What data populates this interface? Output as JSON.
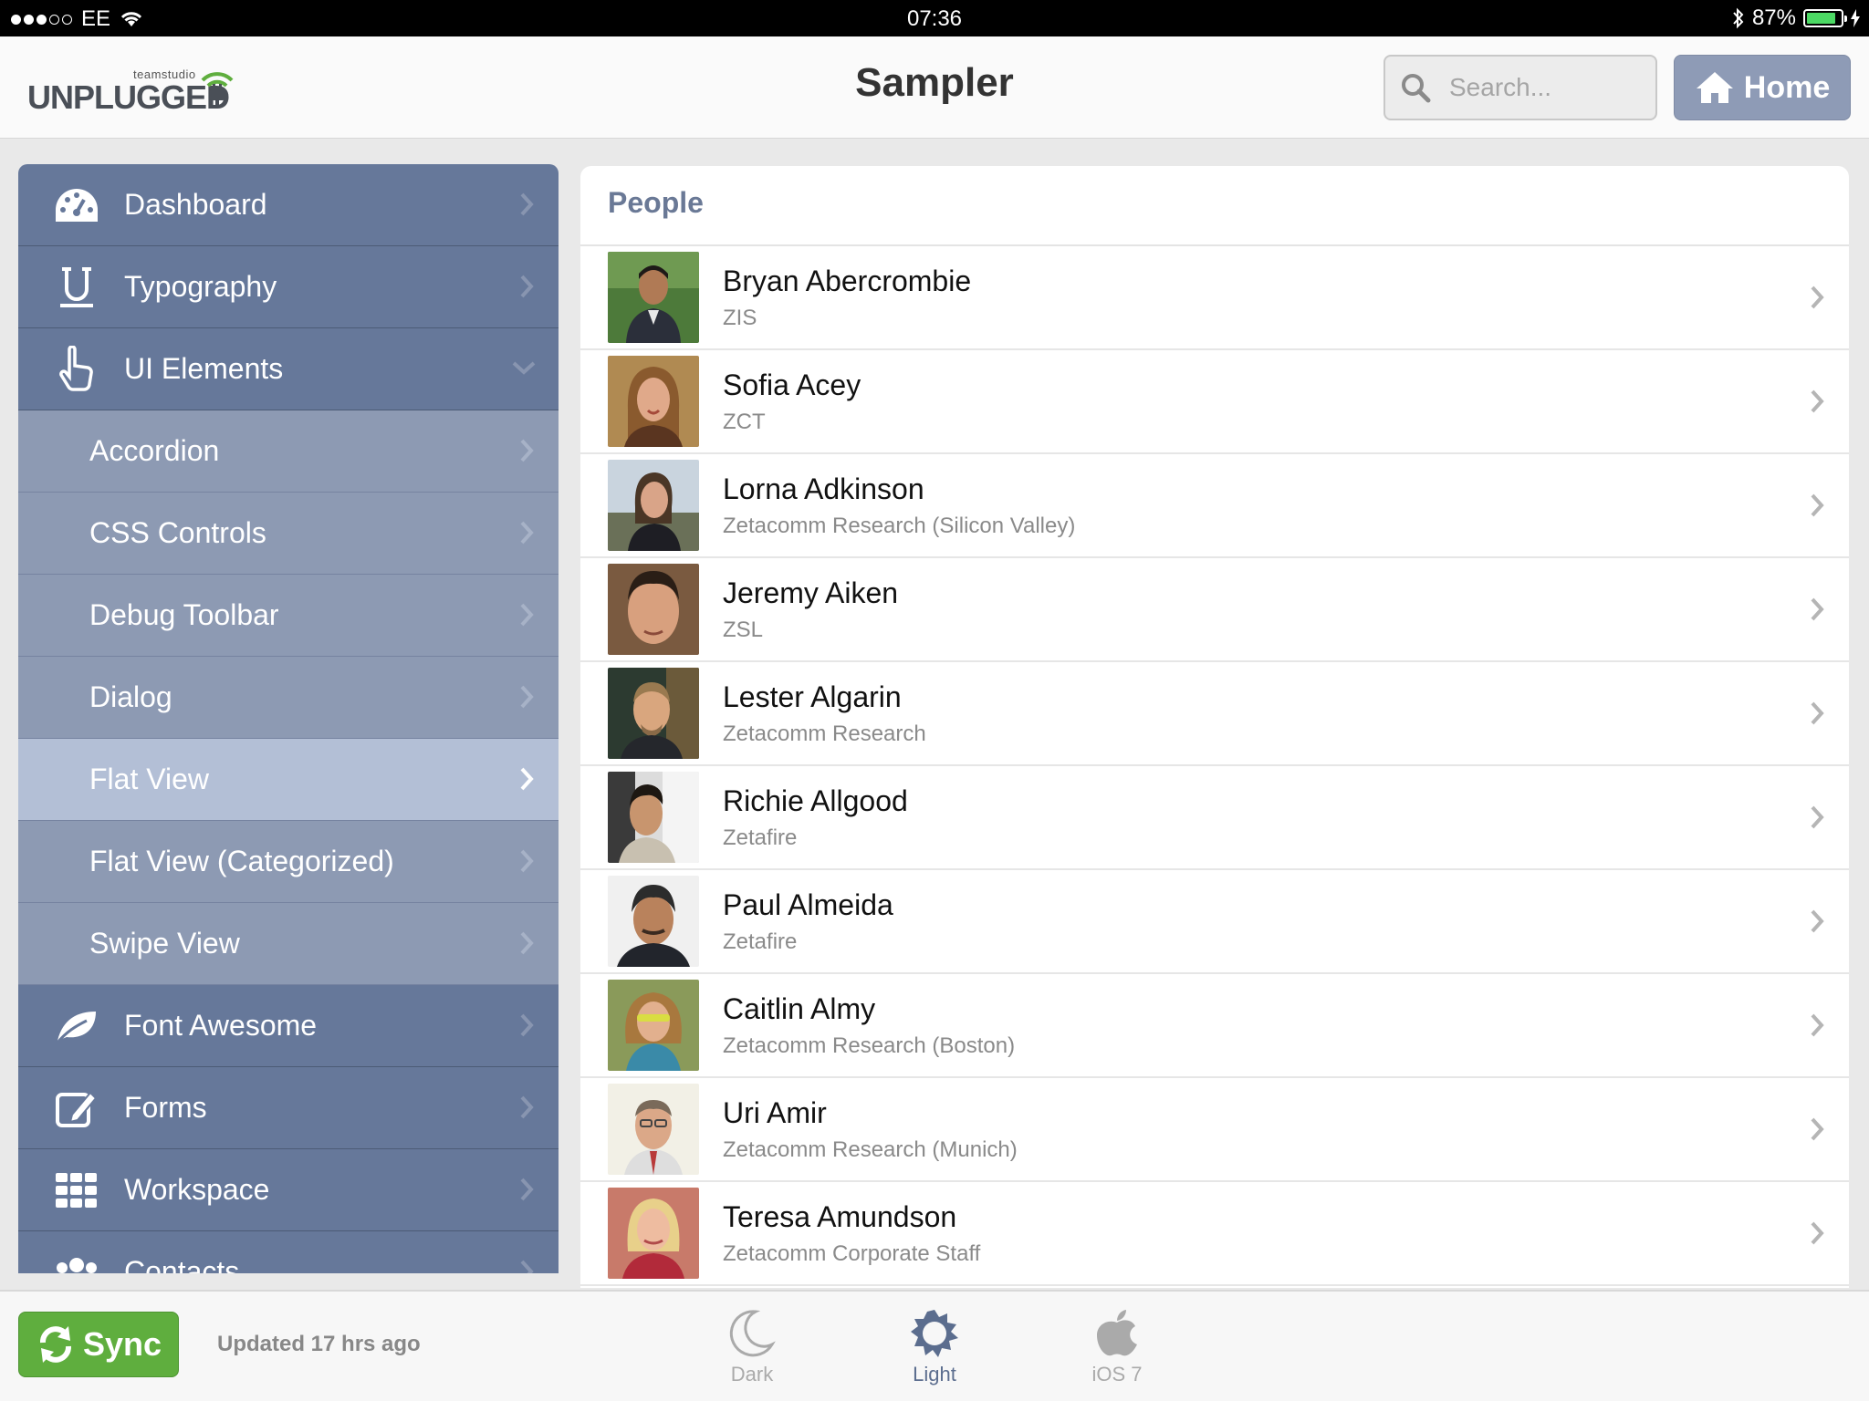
{
  "status_bar": {
    "carrier": "EE",
    "time": "07:36",
    "battery": "87%",
    "battery_level": 0.87
  },
  "header": {
    "logo_small": "teamstudio",
    "logo_big": "UNPLUGGED",
    "title": "Sampler",
    "search_placeholder": "Search...",
    "home_label": "Home"
  },
  "sidebar": {
    "items": [
      {
        "label": "Dashboard",
        "icon": "dashboard-icon"
      },
      {
        "label": "Typography",
        "icon": "underline-icon"
      },
      {
        "label": "UI Elements",
        "icon": "pointer-hand-icon"
      },
      {
        "label": "Accordion"
      },
      {
        "label": "CSS Controls"
      },
      {
        "label": "Debug Toolbar"
      },
      {
        "label": "Dialog"
      },
      {
        "label": "Flat View",
        "active": true
      },
      {
        "label": "Flat View (Categorized)"
      },
      {
        "label": "Swipe View"
      },
      {
        "label": "Font Awesome",
        "icon": "leaf-icon"
      },
      {
        "label": "Forms",
        "icon": "edit-icon"
      },
      {
        "label": "Workspace",
        "icon": "grid-icon"
      },
      {
        "label": "Contacts",
        "icon": "group-icon"
      }
    ]
  },
  "main": {
    "title": "People",
    "people": [
      {
        "name": "Bryan Abercrombie",
        "org": "ZIS"
      },
      {
        "name": "Sofia Acey",
        "org": "ZCT"
      },
      {
        "name": "Lorna Adkinson",
        "org": "Zetacomm Research (Silicon Valley)"
      },
      {
        "name": "Jeremy Aiken",
        "org": "ZSL"
      },
      {
        "name": "Lester Algarin",
        "org": "Zetacomm Research"
      },
      {
        "name": "Richie Allgood",
        "org": "Zetafire"
      },
      {
        "name": "Paul Almeida",
        "org": "Zetafire"
      },
      {
        "name": "Caitlin Almy",
        "org": "Zetacomm Research (Boston)"
      },
      {
        "name": "Uri Amir",
        "org": "Zetacomm Research (Munich)"
      },
      {
        "name": "Teresa Amundson",
        "org": "Zetacomm Corporate Staff"
      }
    ]
  },
  "footer": {
    "sync_label": "Sync",
    "updated": "Updated 17 hrs ago",
    "themes": {
      "dark": "Dark",
      "light": "Light",
      "ios7": "iOS 7"
    }
  },
  "colors": {
    "nav_top": "#66789a",
    "nav_sub": "#8d9ab3",
    "nav_active": "#b3bfd6",
    "home_button": "#8e9bb6",
    "sync_button": "#5fae3e",
    "accent_text": "#6a7996"
  }
}
